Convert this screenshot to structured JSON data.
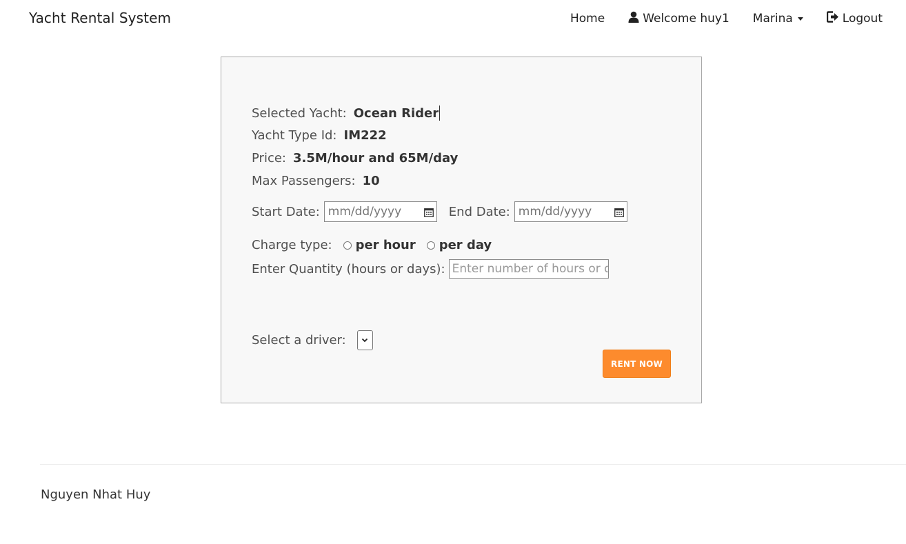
{
  "navbar": {
    "brand": "Yacht Rental System",
    "home": "Home",
    "welcome": "Welcome huy1",
    "marina": "Marina",
    "logout": "Logout"
  },
  "yacht": {
    "selected_label": "Selected Yacht:",
    "selected_value": "Ocean Rider",
    "type_label": "Yacht Type Id:",
    "type_value": "IM222",
    "price_label": "Price:",
    "price_value": "3.5M/hour and 65M/day",
    "passengers_label": "Max Passengers:",
    "passengers_value": "10"
  },
  "form": {
    "start_label": "Start Date:",
    "start_placeholder": "mm/dd/yyyy",
    "end_label": "End Date:",
    "end_placeholder": "mm/dd/yyyy",
    "charge_label": "Charge type:",
    "per_hour": "per hour",
    "per_day": "per day",
    "quantity_label": "Enter Quantity (hours or days):",
    "quantity_placeholder": "Enter number of hours or days",
    "driver_label": "Select a driver:",
    "rent_button": "RENT NOW"
  },
  "footer": {
    "author": "Nguyen Nhat Huy"
  },
  "colors": {
    "accent": "#fd8b2d",
    "panel_bg": "#f8f8f8"
  }
}
